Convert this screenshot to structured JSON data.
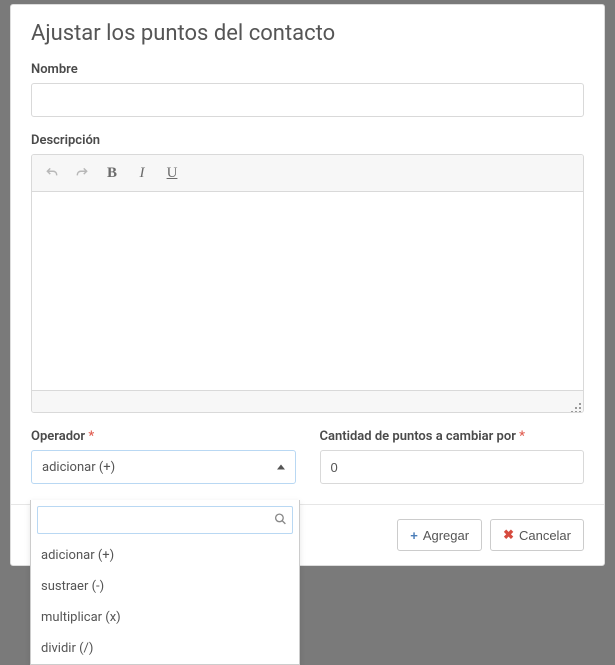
{
  "modal": {
    "title": "Ajustar los puntos del contacto"
  },
  "fields": {
    "name_label": "Nombre",
    "name_value": "",
    "description_label": "Descripción",
    "operator_label": "Operador",
    "operator_selected": "adicionar (+)",
    "points_label": "Cantidad de puntos a cambiar por",
    "points_value": "0"
  },
  "dropdown": {
    "search_value": "",
    "options": [
      "adicionar (+)",
      "sustraer (-)",
      "multiplicar (x)",
      "dividir (/)"
    ]
  },
  "footer": {
    "add_label": "Agregar",
    "cancel_label": "Cancelar"
  }
}
